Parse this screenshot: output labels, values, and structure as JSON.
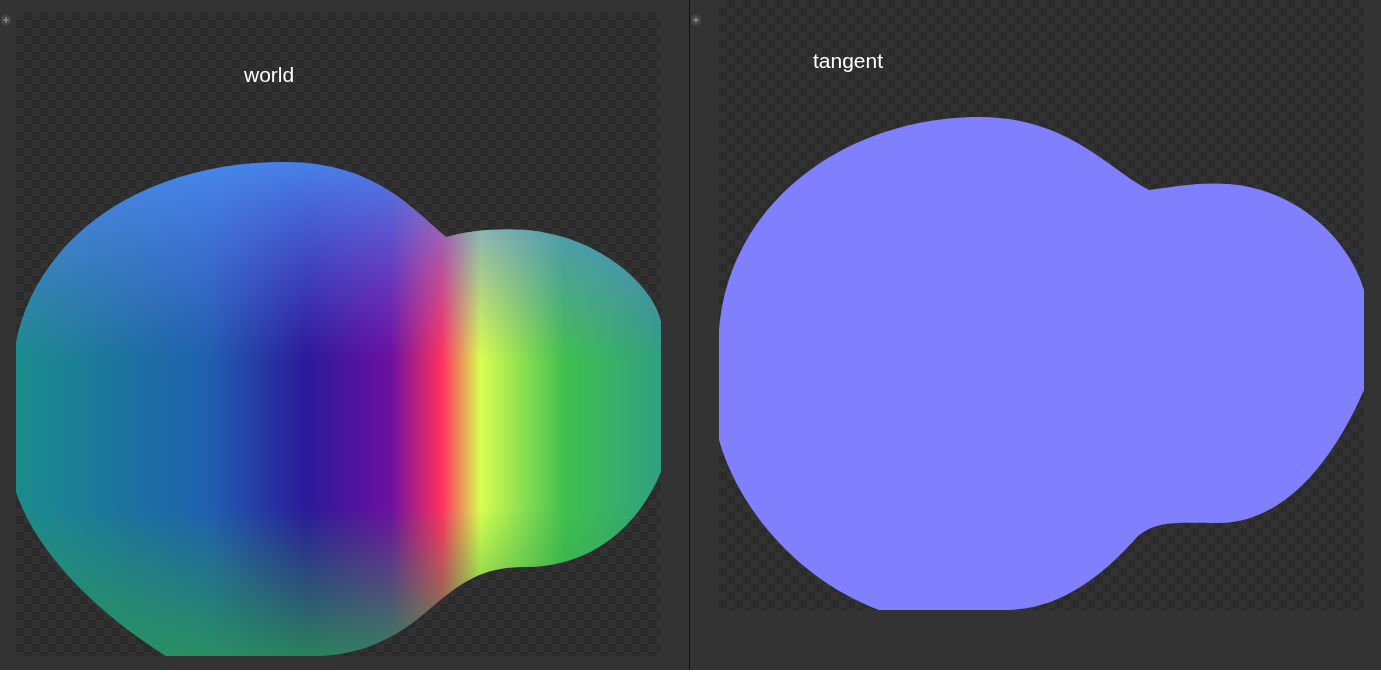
{
  "panels": [
    {
      "label": "world",
      "kind": "world"
    },
    {
      "label": "tangent",
      "kind": "tangent"
    }
  ]
}
